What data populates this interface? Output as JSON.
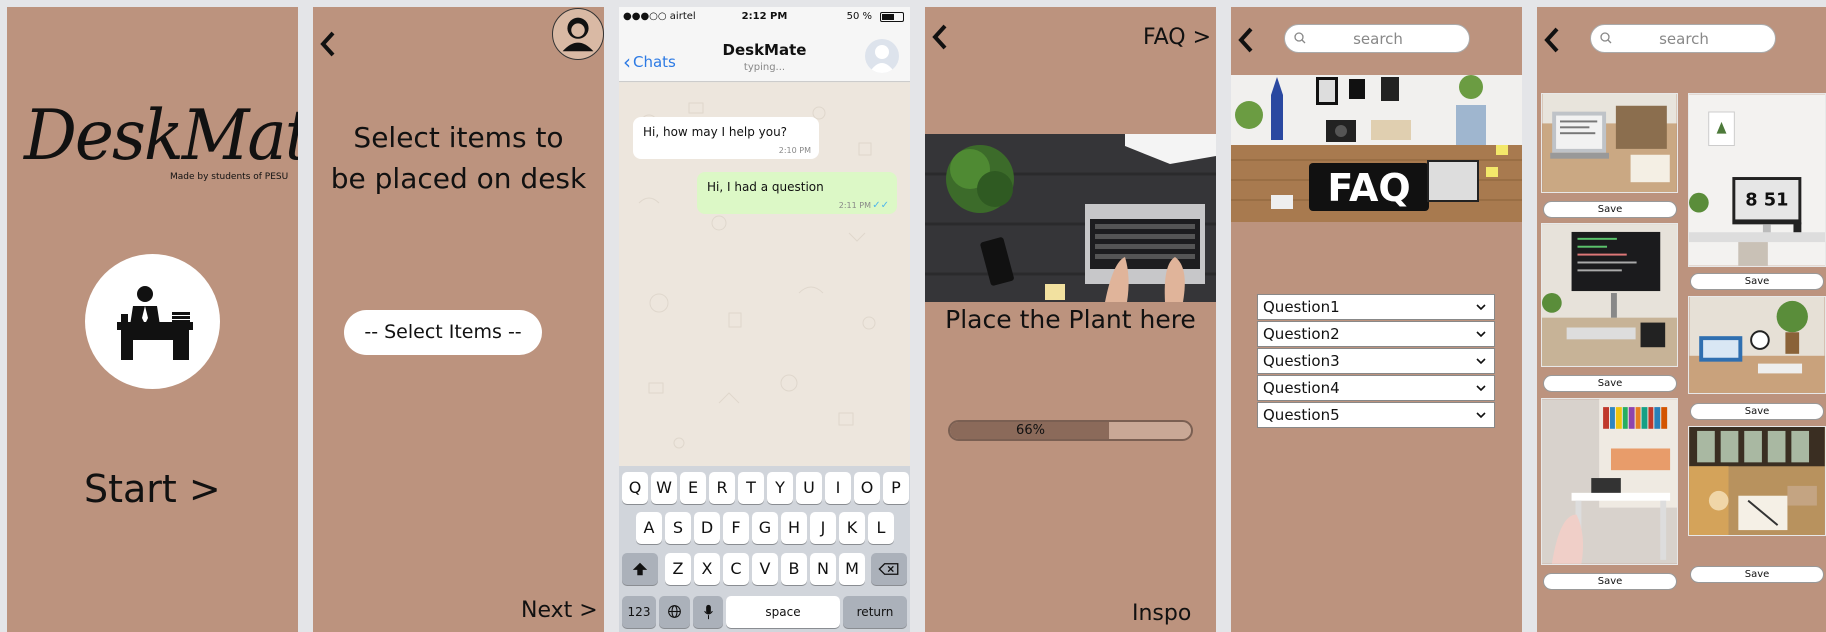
{
  "panel1": {
    "logo": "DeskMate",
    "tagline": "Made by students of PESU",
    "start": "Start >"
  },
  "panel2": {
    "title_line1": "Select items to",
    "title_line2": "be placed on desk",
    "select_label": "-- Select Items --",
    "next": "Next >"
  },
  "panel3": {
    "carrier": "●●●○○ airtel",
    "time": "2:12 PM",
    "battery": "50 %",
    "back_label": "Chats",
    "contact": "DeskMate",
    "typing": "typing...",
    "messages": [
      {
        "text": "Hi, how may I help you?",
        "time": "2:10 PM"
      },
      {
        "text": "Hi, I had a question",
        "time": "2:11 PM"
      }
    ],
    "keys_row1": [
      "Q",
      "W",
      "E",
      "R",
      "T",
      "Y",
      "U",
      "I",
      "O",
      "P"
    ],
    "keys_row2": [
      "A",
      "S",
      "D",
      "F",
      "G",
      "H",
      "J",
      "K",
      "L"
    ],
    "keys_row3": [
      "Z",
      "X",
      "C",
      "V",
      "B",
      "N",
      "M"
    ],
    "key_123": "123",
    "key_space": "space",
    "key_return": "return"
  },
  "panel4": {
    "faq_link": "FAQ >",
    "caption": "Place the Plant here",
    "progress": 66,
    "progress_label": "66%",
    "inspo": "Inspo >"
  },
  "panel5": {
    "search_placeholder": "search",
    "banner_text": "FAQ",
    "questions": [
      "Question1",
      "Question2",
      "Question3",
      "Question4",
      "Question5"
    ]
  },
  "panel6": {
    "search_placeholder": "search",
    "clock_text": "8 51",
    "save_label": "Save"
  }
}
